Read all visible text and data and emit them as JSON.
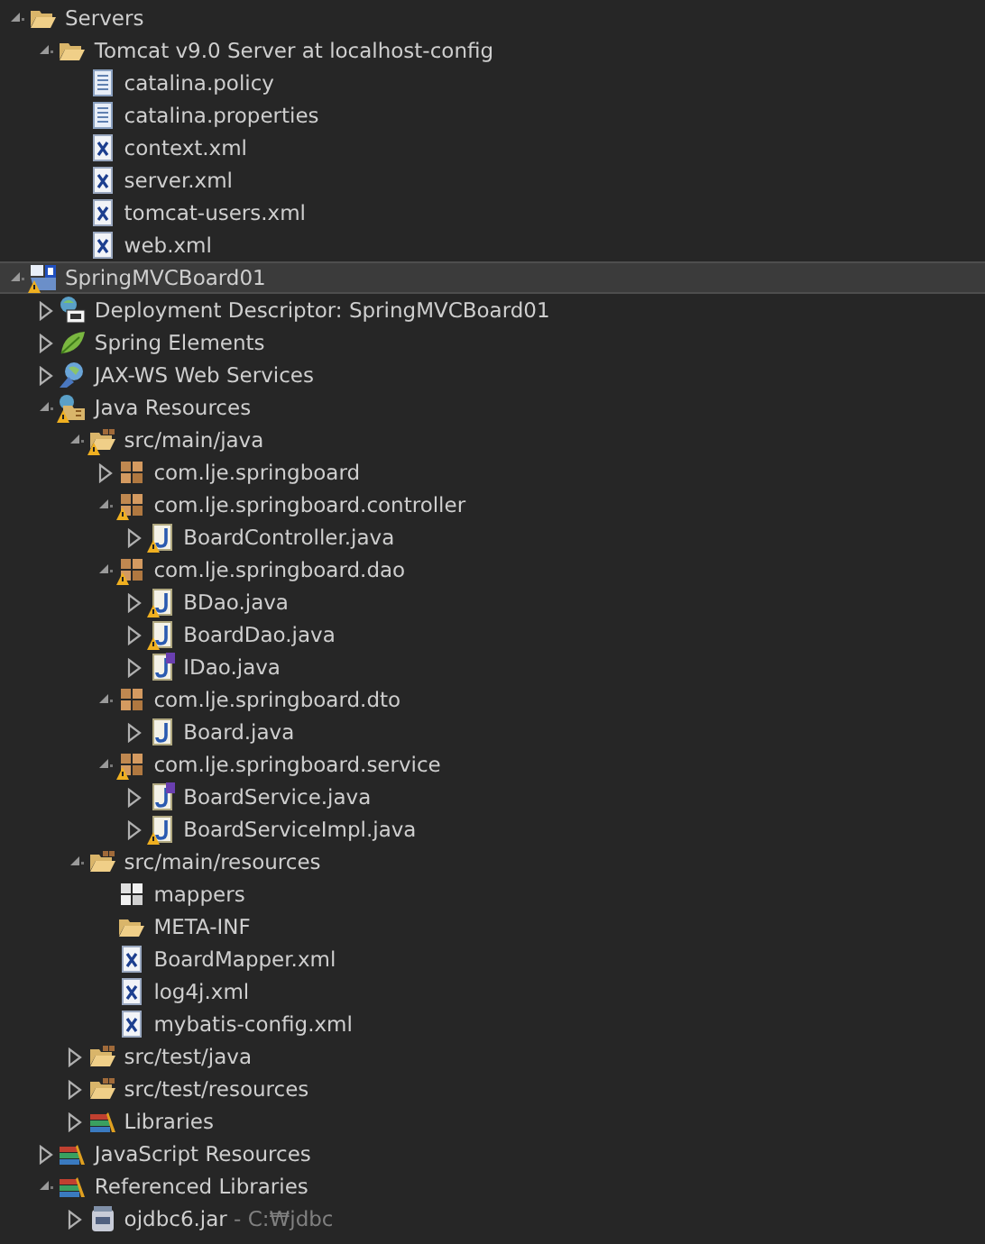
{
  "tree": [
    {
      "label": "Servers",
      "kind": "folder",
      "expanded": true,
      "selected": false,
      "warning": false,
      "children": [
        {
          "label": "Tomcat v9.0 Server at localhost-config",
          "kind": "folder",
          "expanded": true,
          "selected": false,
          "warning": false,
          "children": [
            {
              "label": "catalina.policy",
              "kind": "file",
              "selected": false,
              "warning": false
            },
            {
              "label": "catalina.properties",
              "kind": "file",
              "selected": false,
              "warning": false
            },
            {
              "label": "context.xml",
              "kind": "xml",
              "selected": false,
              "warning": false
            },
            {
              "label": "server.xml",
              "kind": "xml",
              "selected": false,
              "warning": false
            },
            {
              "label": "tomcat-users.xml",
              "kind": "xml",
              "selected": false,
              "warning": false
            },
            {
              "label": "web.xml",
              "kind": "xml",
              "selected": false,
              "warning": false
            }
          ]
        }
      ]
    },
    {
      "label": "SpringMVCBoard01",
      "kind": "project",
      "expanded": true,
      "selected": true,
      "warning": true,
      "children": [
        {
          "label": "Deployment Descriptor: SpringMVCBoard01",
          "kind": "descriptor",
          "expanded": false,
          "selected": false,
          "warning": false
        },
        {
          "label": "Spring Elements",
          "kind": "spring",
          "expanded": false,
          "selected": false,
          "warning": false
        },
        {
          "label": "JAX-WS Web Services",
          "kind": "webservice",
          "expanded": false,
          "selected": false,
          "warning": false
        },
        {
          "label": "Java Resources",
          "kind": "javares",
          "expanded": true,
          "selected": false,
          "warning": true,
          "children": [
            {
              "label": "src/main/java",
              "kind": "srcfolder",
              "expanded": true,
              "selected": false,
              "warning": true,
              "children": [
                {
                  "label": "com.lje.springboard",
                  "kind": "package",
                  "expanded": false,
                  "selected": false,
                  "warning": false
                },
                {
                  "label": "com.lje.springboard.controller",
                  "kind": "package",
                  "expanded": true,
                  "selected": false,
                  "warning": true,
                  "children": [
                    {
                      "label": "BoardController.java",
                      "kind": "java",
                      "expanded": false,
                      "selected": false,
                      "warning": true
                    }
                  ]
                },
                {
                  "label": "com.lje.springboard.dao",
                  "kind": "package",
                  "expanded": true,
                  "selected": false,
                  "warning": true,
                  "children": [
                    {
                      "label": "BDao.java",
                      "kind": "java",
                      "expanded": false,
                      "selected": false,
                      "warning": true
                    },
                    {
                      "label": "BoardDao.java",
                      "kind": "java",
                      "expanded": false,
                      "selected": false,
                      "warning": true
                    },
                    {
                      "label": "IDao.java",
                      "kind": "interface",
                      "expanded": false,
                      "selected": false,
                      "warning": false
                    }
                  ]
                },
                {
                  "label": "com.lje.springboard.dto",
                  "kind": "package",
                  "expanded": true,
                  "selected": false,
                  "warning": false,
                  "children": [
                    {
                      "label": "Board.java",
                      "kind": "java",
                      "expanded": false,
                      "selected": false,
                      "warning": false
                    }
                  ]
                },
                {
                  "label": "com.lje.springboard.service",
                  "kind": "package",
                  "expanded": true,
                  "selected": false,
                  "warning": true,
                  "children": [
                    {
                      "label": "BoardService.java",
                      "kind": "interface",
                      "expanded": false,
                      "selected": false,
                      "warning": false
                    },
                    {
                      "label": "BoardServiceImpl.java",
                      "kind": "java",
                      "expanded": false,
                      "selected": false,
                      "warning": true
                    }
                  ]
                }
              ]
            },
            {
              "label": "src/main/resources",
              "kind": "srcfolder",
              "expanded": true,
              "selected": false,
              "warning": false,
              "children": [
                {
                  "label": "mappers",
                  "kind": "emptypackage",
                  "selected": false,
                  "warning": false
                },
                {
                  "label": "META-INF",
                  "kind": "folder",
                  "selected": false,
                  "warning": false
                },
                {
                  "label": "BoardMapper.xml",
                  "kind": "xml",
                  "selected": false,
                  "warning": false
                },
                {
                  "label": "log4j.xml",
                  "kind": "xml",
                  "selected": false,
                  "warning": false
                },
                {
                  "label": "mybatis-config.xml",
                  "kind": "xml",
                  "selected": false,
                  "warning": false
                }
              ]
            },
            {
              "label": "src/test/java",
              "kind": "srcfolder",
              "expanded": false,
              "selected": false,
              "warning": false
            },
            {
              "label": "src/test/resources",
              "kind": "srcfolder",
              "expanded": false,
              "selected": false,
              "warning": false
            },
            {
              "label": "Libraries",
              "kind": "library",
              "expanded": false,
              "selected": false,
              "warning": false
            }
          ]
        },
        {
          "label": "JavaScript Resources",
          "kind": "library",
          "expanded": false,
          "selected": false,
          "warning": false
        },
        {
          "label": "Referenced Libraries",
          "kind": "library",
          "expanded": true,
          "selected": false,
          "warning": false,
          "children": [
            {
              "label": "ojdbc6.jar",
              "decoration": " - C:₩jdbc",
              "kind": "jar",
              "expanded": false,
              "selected": false,
              "warning": false
            }
          ]
        }
      ]
    }
  ]
}
